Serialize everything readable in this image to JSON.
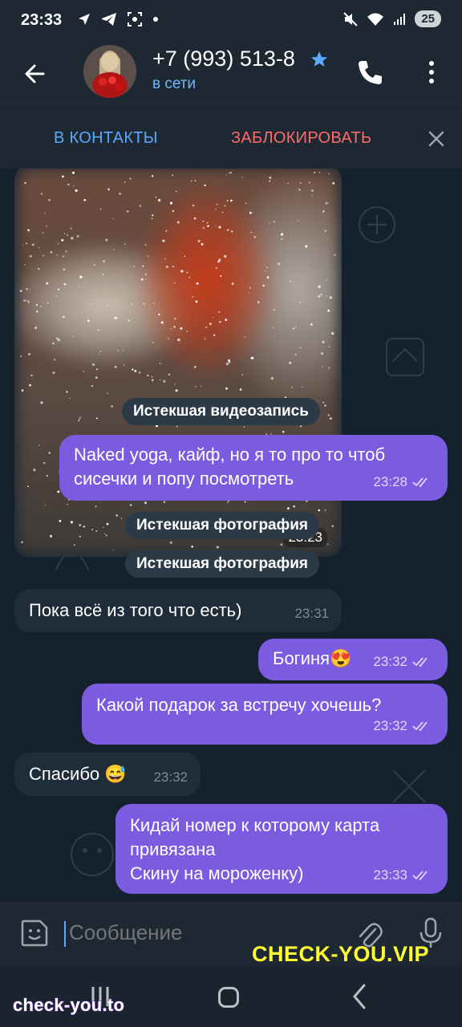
{
  "status_bar": {
    "time": "23:33",
    "battery": "25"
  },
  "header": {
    "contact_name": "+7 (993) 513-8",
    "status": "в сети"
  },
  "action_bar": {
    "add_contact": "В КОНТАКТЫ",
    "block": "ЗАБЛОКИРОВАТЬ"
  },
  "messages": [
    {
      "type": "media",
      "time": "23:23"
    },
    {
      "type": "service",
      "text": "Истекшая видеозапись"
    },
    {
      "type": "outgoing",
      "text": "Naked yoga, кайф, но я то про то чтоб сисечки  и попу посмотреть",
      "time": "23:28"
    },
    {
      "type": "service",
      "text": "Истекшая фотография"
    },
    {
      "type": "service",
      "text": "Истекшая фотография"
    },
    {
      "type": "incoming",
      "text": "Пока всё из того что есть)",
      "time": "23:31"
    },
    {
      "type": "outgoing",
      "text": "Богиня",
      "emoji": "😍",
      "time": "23:32"
    },
    {
      "type": "outgoing",
      "text": "Какой подарок за встречу хочешь?",
      "time": "23:32"
    },
    {
      "type": "incoming",
      "text": "Спасибо",
      "emoji": "😅",
      "time": "23:32"
    },
    {
      "type": "outgoing",
      "text": "Кидай номер к которому карта\nпривязана\nСкину на мороженку)",
      "time": "23:33"
    }
  ],
  "composer": {
    "placeholder": "Сообщение"
  },
  "watermarks": {
    "right": "CHECK-YOU.VIP",
    "left": "check-you.to"
  },
  "colors": {
    "outgoing_bubble": "#7b5be0",
    "incoming_bubble": "#1f2c39",
    "accent": "#5aa8ff",
    "block": "#ff6b6b"
  }
}
